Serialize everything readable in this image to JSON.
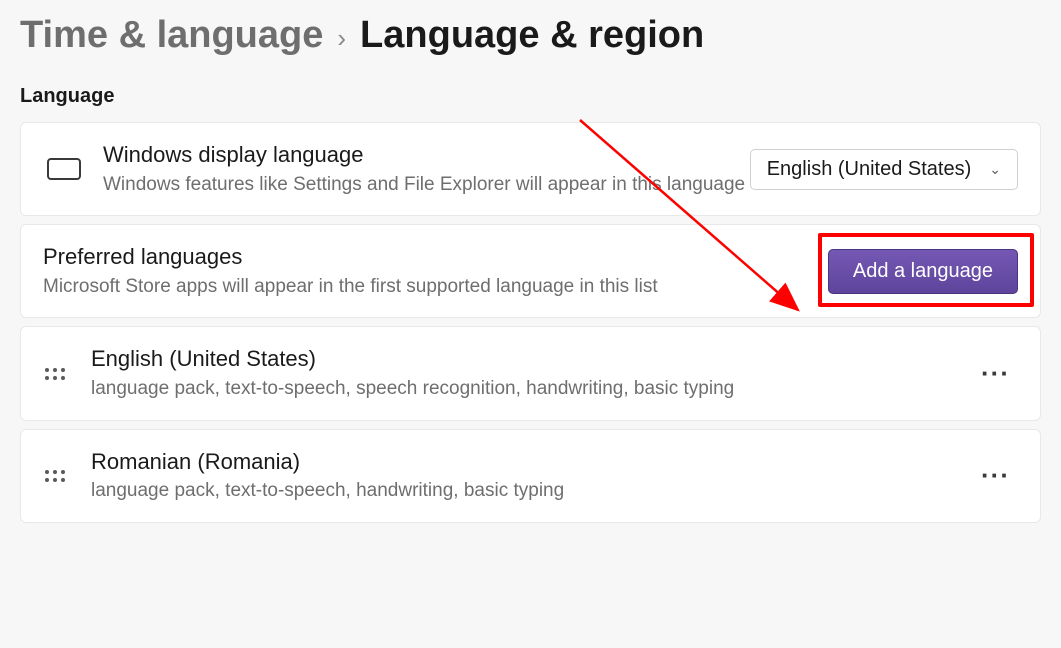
{
  "breadcrumb": {
    "parent": "Time & language",
    "current": "Language & region"
  },
  "section": {
    "title": "Language"
  },
  "displayLang": {
    "title": "Windows display language",
    "sub": "Windows features like Settings and File Explorer will appear in this language",
    "selected": "English (United States)"
  },
  "preferred": {
    "title": "Preferred languages",
    "sub": "Microsoft Store apps will appear in the first supported language in this list",
    "addLabel": "Add a language"
  },
  "languages": [
    {
      "name": "English (United States)",
      "features": "language pack, text-to-speech, speech recognition, handwriting, basic typing"
    },
    {
      "name": "Romanian (Romania)",
      "features": "language pack, text-to-speech, handwriting, basic typing"
    }
  ]
}
